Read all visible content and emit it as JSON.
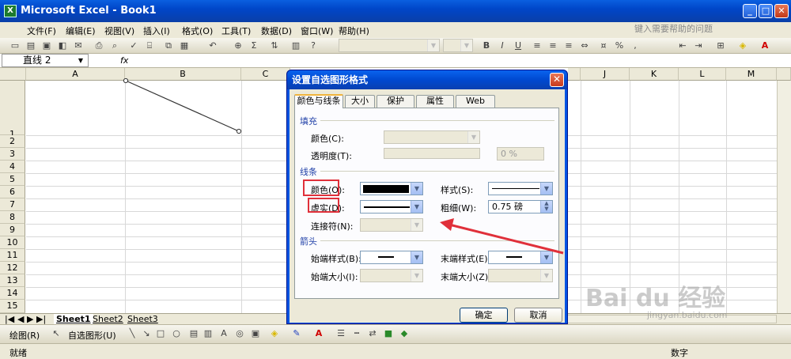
{
  "window": {
    "title": "Microsoft Excel - Book1",
    "app_icon": "excel-icon",
    "min": "_",
    "max": "□",
    "close": "✕"
  },
  "menu": {
    "items": [
      "文件(F)",
      "编辑(E)",
      "视图(V)",
      "插入(I)",
      "格式(O)",
      "工具(T)",
      "数据(D)",
      "窗口(W)",
      "帮助(H)"
    ],
    "help_search": "键入需要帮助的问题"
  },
  "formula_bar": {
    "name_box": "直线 2",
    "fx": "fx"
  },
  "sheet": {
    "columns": [
      "A",
      "B",
      "C",
      "J",
      "K",
      "L",
      "M"
    ],
    "rows": [
      "1",
      "2",
      "3",
      "4",
      "5",
      "6",
      "7",
      "8",
      "9",
      "10",
      "11",
      "12",
      "13",
      "14",
      "15"
    ]
  },
  "sheet_tabs": [
    "Sheet1",
    "Sheet2",
    "Sheet3"
  ],
  "draw_toolbar": {
    "draw": "绘图(R)",
    "autoshapes": "自选图形(U)"
  },
  "status": {
    "left": "就绪",
    "right": "数字"
  },
  "dialog": {
    "title": "设置自选图形格式",
    "tabs": [
      "颜色与线条",
      "大小",
      "保护",
      "属性",
      "Web"
    ],
    "fill": {
      "section": "填充",
      "color_label": "颜色(C):",
      "transparency_label": "透明度(T):",
      "transparency_value": "0 %"
    },
    "line": {
      "section": "线条",
      "color_label": "颜色(O):",
      "dash_label": "虚实(D):",
      "connector_label": "连接符(N):",
      "style_label": "样式(S):",
      "weight_label": "粗细(W):",
      "weight_value": "0.75 磅",
      "line_color": "#000000"
    },
    "arrows": {
      "section": "箭头",
      "begin_style_label": "始端样式(B):",
      "begin_size_label": "始端大小(I):",
      "end_style_label": "末端样式(E):",
      "end_size_label": "末端大小(Z):"
    },
    "ok": "确定",
    "cancel": "取消"
  },
  "watermark": {
    "text": "Bai du 经验",
    "url": "jingyan.baidu.com"
  }
}
